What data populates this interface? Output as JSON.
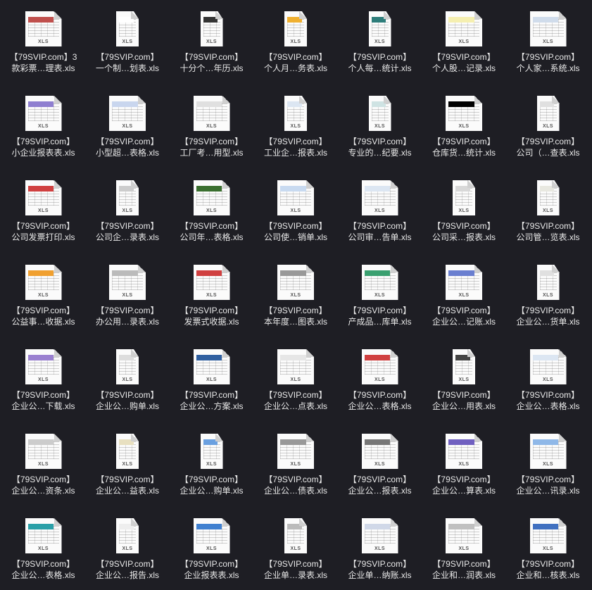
{
  "thumb_badge": "XLS",
  "files": [
    {
      "line1": "【79SVIP.com】3",
      "line2": "款彩票…理表.xls",
      "accent": "#c0504d",
      "portrait": false
    },
    {
      "line1": "【79SVIP.com】",
      "line2": "一个制…划表.xls",
      "accent": "#ffffff",
      "portrait": true
    },
    {
      "line1": "【79SVIP.com】",
      "line2": "十分个…年历.xls",
      "accent": "#333333",
      "portrait": true
    },
    {
      "line1": "【79SVIP.com】",
      "line2": "个人月…务表.xls",
      "accent": "#f0b030",
      "portrait": true
    },
    {
      "line1": "【79SVIP.com】",
      "line2": "个人每…统计.xls",
      "accent": "#2e7d7a",
      "portrait": true
    },
    {
      "line1": "【79SVIP.com】",
      "line2": "个人股…记录.xls",
      "accent": "#f5efb0",
      "portrait": false
    },
    {
      "line1": "【79SVIP.com】",
      "line2": "个人家…系统.xls",
      "accent": "#d0dceb",
      "portrait": false
    },
    {
      "line1": "【79SVIP.com】",
      "line2": "小企业报表表.xls",
      "accent": "#8f7fd0",
      "portrait": false
    },
    {
      "line1": "【79SVIP.com】",
      "line2": "小型超…表格.xls",
      "accent": "#c9d6ee",
      "portrait": false
    },
    {
      "line1": "【79SVIP.com】",
      "line2": "工厂考…用型.xls",
      "accent": "#e0e0e0",
      "portrait": false
    },
    {
      "line1": "【79SVIP.com】",
      "line2": "工业企…报表.xls",
      "accent": "#dce6f2",
      "portrait": true
    },
    {
      "line1": "【79SVIP.com】",
      "line2": "专业的…纪要.xls",
      "accent": "#cfe3e3",
      "portrait": true
    },
    {
      "line1": "【79SVIP.com】",
      "line2": "仓库货…统计.xls",
      "accent": "#000000",
      "portrait": false
    },
    {
      "line1": "【79SVIP.com】",
      "line2": "公司（…查表.xls",
      "accent": "#e0e0e0",
      "portrait": true
    },
    {
      "line1": "【79SVIP.com】",
      "line2": "公司发票打印.xls",
      "accent": "#d04040",
      "portrait": false
    },
    {
      "line1": "【79SVIP.com】",
      "line2": "公司企…录表.xls",
      "accent": "#cccccc",
      "portrait": true
    },
    {
      "line1": "【79SVIP.com】",
      "line2": "公司年…表格.xls",
      "accent": "#3a6f2f",
      "portrait": false
    },
    {
      "line1": "【79SVIP.com】",
      "line2": "公司使…销单.xls",
      "accent": "#c8daf0",
      "portrait": false
    },
    {
      "line1": "【79SVIP.com】",
      "line2": "公司审…告单.xls",
      "accent": "#dce6f2",
      "portrait": false
    },
    {
      "line1": "【79SVIP.com】",
      "line2": "公司采…报表.xls",
      "accent": "#d8d8d8",
      "portrait": true
    },
    {
      "line1": "【79SVIP.com】",
      "line2": "公司管…览表.xls",
      "accent": "#e8e8e0",
      "portrait": true
    },
    {
      "line1": "【79SVIP.com】",
      "line2": "公益事…收据.xls",
      "accent": "#f0a030",
      "portrait": false
    },
    {
      "line1": "【79SVIP.com】",
      "line2": "办公用…录表.xls",
      "accent": "#bbbbbb",
      "portrait": false
    },
    {
      "line1": "【79SVIP.com】",
      "line2": "发票式收据.xls",
      "accent": "#d04040",
      "portrait": false
    },
    {
      "line1": "【79SVIP.com】",
      "line2": "本年度…图表.xls",
      "accent": "#999999",
      "portrait": false
    },
    {
      "line1": "【79SVIP.com】",
      "line2": "产成品…库单.xls",
      "accent": "#3aa070",
      "portrait": false
    },
    {
      "line1": "【79SVIP.com】",
      "line2": "企业公…记账.xls",
      "accent": "#6a7fd0",
      "portrait": false
    },
    {
      "line1": "【79SVIP.com】",
      "line2": "企业公…货单.xls",
      "accent": "#e0e0e0",
      "portrait": true
    },
    {
      "line1": "【79SVIP.com】",
      "line2": "企业公…下载.xls",
      "accent": "#9a80d0",
      "portrait": false
    },
    {
      "line1": "【79SVIP.com】",
      "line2": "企业公…购单.xls",
      "accent": "#dddddd",
      "portrait": true
    },
    {
      "line1": "【79SVIP.com】",
      "line2": "企业公…方案.xls",
      "accent": "#2f5fa0",
      "portrait": false
    },
    {
      "line1": "【79SVIP.com】",
      "line2": "企业公…点表.xls",
      "accent": "#e6e6e6",
      "portrait": false
    },
    {
      "line1": "【79SVIP.com】",
      "line2": "企业公…表格.xls",
      "accent": "#d04040",
      "portrait": false
    },
    {
      "line1": "【79SVIP.com】",
      "line2": "企业公…用表.xls",
      "accent": "#444444",
      "portrait": true
    },
    {
      "line1": "【79SVIP.com】",
      "line2": "企业公…表格.xls",
      "accent": "#dce6f2",
      "portrait": false
    },
    {
      "line1": "【79SVIP.com】",
      "line2": "企业公…资条.xls",
      "accent": "#cccccc",
      "portrait": false
    },
    {
      "line1": "【79SVIP.com】",
      "line2": "企业公…益表.xls",
      "accent": "#e8e0c0",
      "portrait": true
    },
    {
      "line1": "【79SVIP.com】",
      "line2": "企业公…购单.xls",
      "accent": "#6aa0e0",
      "portrait": true
    },
    {
      "line1": "【79SVIP.com】",
      "line2": "企业公…债表.xls",
      "accent": "#999999",
      "portrait": false
    },
    {
      "line1": "【79SVIP.com】",
      "line2": "企业公…报表.xls",
      "accent": "#777777",
      "portrait": false
    },
    {
      "line1": "【79SVIP.com】",
      "line2": "企业公…算表.xls",
      "accent": "#7060c0",
      "portrait": false
    },
    {
      "line1": "【79SVIP.com】",
      "line2": "企业公…讯录.xls",
      "accent": "#8fb8e8",
      "portrait": false
    },
    {
      "line1": "【79SVIP.com】",
      "line2": "企业公…表格.xls",
      "accent": "#2aa0a8",
      "portrait": false
    },
    {
      "line1": "【79SVIP.com】",
      "line2": "企业公…报告.xls",
      "accent": "#eeeeee",
      "portrait": true
    },
    {
      "line1": "【79SVIP.com】",
      "line2": "企业报表表.xls",
      "accent": "#4080d0",
      "portrait": false
    },
    {
      "line1": "【79SVIP.com】",
      "line2": "企业单…录表.xls",
      "accent": "#bbbbbb",
      "portrait": true
    },
    {
      "line1": "【79SVIP.com】",
      "line2": "企业单…纳账.xls",
      "accent": "#d0d8e8",
      "portrait": false
    },
    {
      "line1": "【79SVIP.com】",
      "line2": "企业和…润表.xls",
      "accent": "#c0c0c0",
      "portrait": false
    },
    {
      "line1": "【79SVIP.com】",
      "line2": "企业和…核表.xls",
      "accent": "#4070c0",
      "portrait": false
    }
  ]
}
